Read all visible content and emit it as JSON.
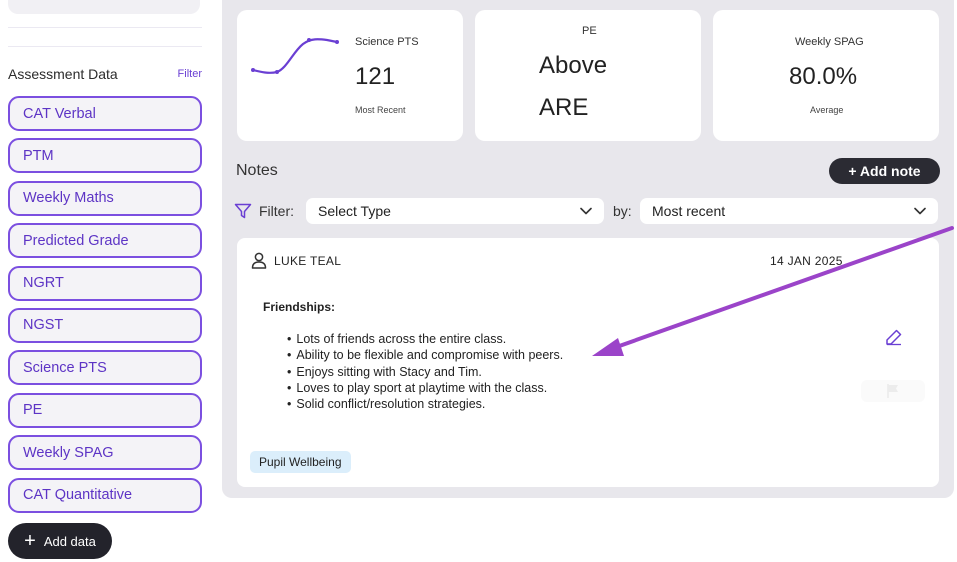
{
  "sidebar": {
    "section_title": "Assessment Data",
    "filter_label": "Filter",
    "items": [
      {
        "label": "CAT Verbal"
      },
      {
        "label": "PTM"
      },
      {
        "label": "Weekly Maths"
      },
      {
        "label": "Predicted Grade"
      },
      {
        "label": "NGRT"
      },
      {
        "label": "NGST"
      },
      {
        "label": "Science PTS"
      },
      {
        "label": "PE"
      },
      {
        "label": "Weekly SPAG"
      },
      {
        "label": "CAT Quantitative"
      }
    ],
    "add_data_label": "Add data"
  },
  "cards": {
    "science": {
      "label": "Science PTS",
      "value": "121",
      "sub": "Most Recent"
    },
    "pe": {
      "label": "PE",
      "value_line1": "Above",
      "value_line2": "ARE"
    },
    "spag": {
      "label": "Weekly SPAG",
      "value": "80.0%",
      "sub": "Average"
    }
  },
  "notes": {
    "title": "Notes",
    "add_note_label": "+ Add note",
    "filter_label": "Filter:",
    "type_select": "Select Type",
    "by_label": "by:",
    "sort_select": "Most recent",
    "note": {
      "author": "LUKE TEAL",
      "date": "14 JAN 2025",
      "heading": "Friendships:",
      "items": [
        "Lots of friends across the entire class.",
        "Ability to be flexible and compromise with peers.",
        "Enjoys sitting with Stacy and Tim.",
        "Loves to play sport at playtime with the class.",
        "Solid conflict/resolution strategies."
      ],
      "tag": "Pupil Wellbeing"
    }
  },
  "colors": {
    "accent": "#6a3fd3",
    "dark_button": "#2b2b33",
    "panel_bg": "#e8e7ec",
    "tag_bg": "#dbeefb",
    "annotation_arrow": "#9b44c9"
  },
  "icons": {
    "sparkline": "sparkline-chart-icon",
    "filter": "funnel-icon",
    "chevron": "chevron-down-icon",
    "user": "user-icon",
    "edit": "pencil-icon",
    "flag": "flag-icon",
    "plus": "plus-icon"
  }
}
